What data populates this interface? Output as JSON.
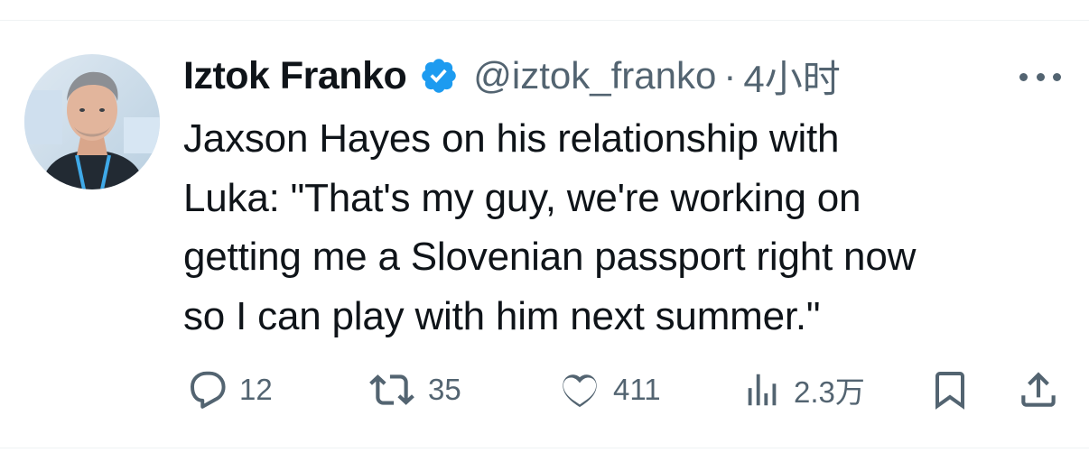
{
  "tweet": {
    "author": {
      "display_name": "Iztok Franko",
      "handle": "@iztok_franko",
      "verified_icon": "verified-badge-icon",
      "verified_color": "#1d9bf0"
    },
    "separator": "·",
    "time_ago": "4小时",
    "text": "Jaxson Hayes on his relationship with\nLuka: \"That's my guy, we're working on\ngetting me a Slovenian passport right now\nso I can play with him next summer.\"",
    "actions": {
      "reply": {
        "icon": "reply-icon",
        "count": "12"
      },
      "retweet": {
        "icon": "retweet-icon",
        "count": "35"
      },
      "like": {
        "icon": "heart-icon",
        "count": "411"
      },
      "views": {
        "icon": "views-icon",
        "count": "2.3万"
      },
      "bookmark": {
        "icon": "bookmark-icon"
      },
      "share": {
        "icon": "share-icon"
      }
    },
    "more_icon": "more-options-icon"
  },
  "colors": {
    "text_primary": "#0f1419",
    "text_secondary": "#536471",
    "divider": "#eff3f4",
    "accent": "#1d9bf0"
  }
}
